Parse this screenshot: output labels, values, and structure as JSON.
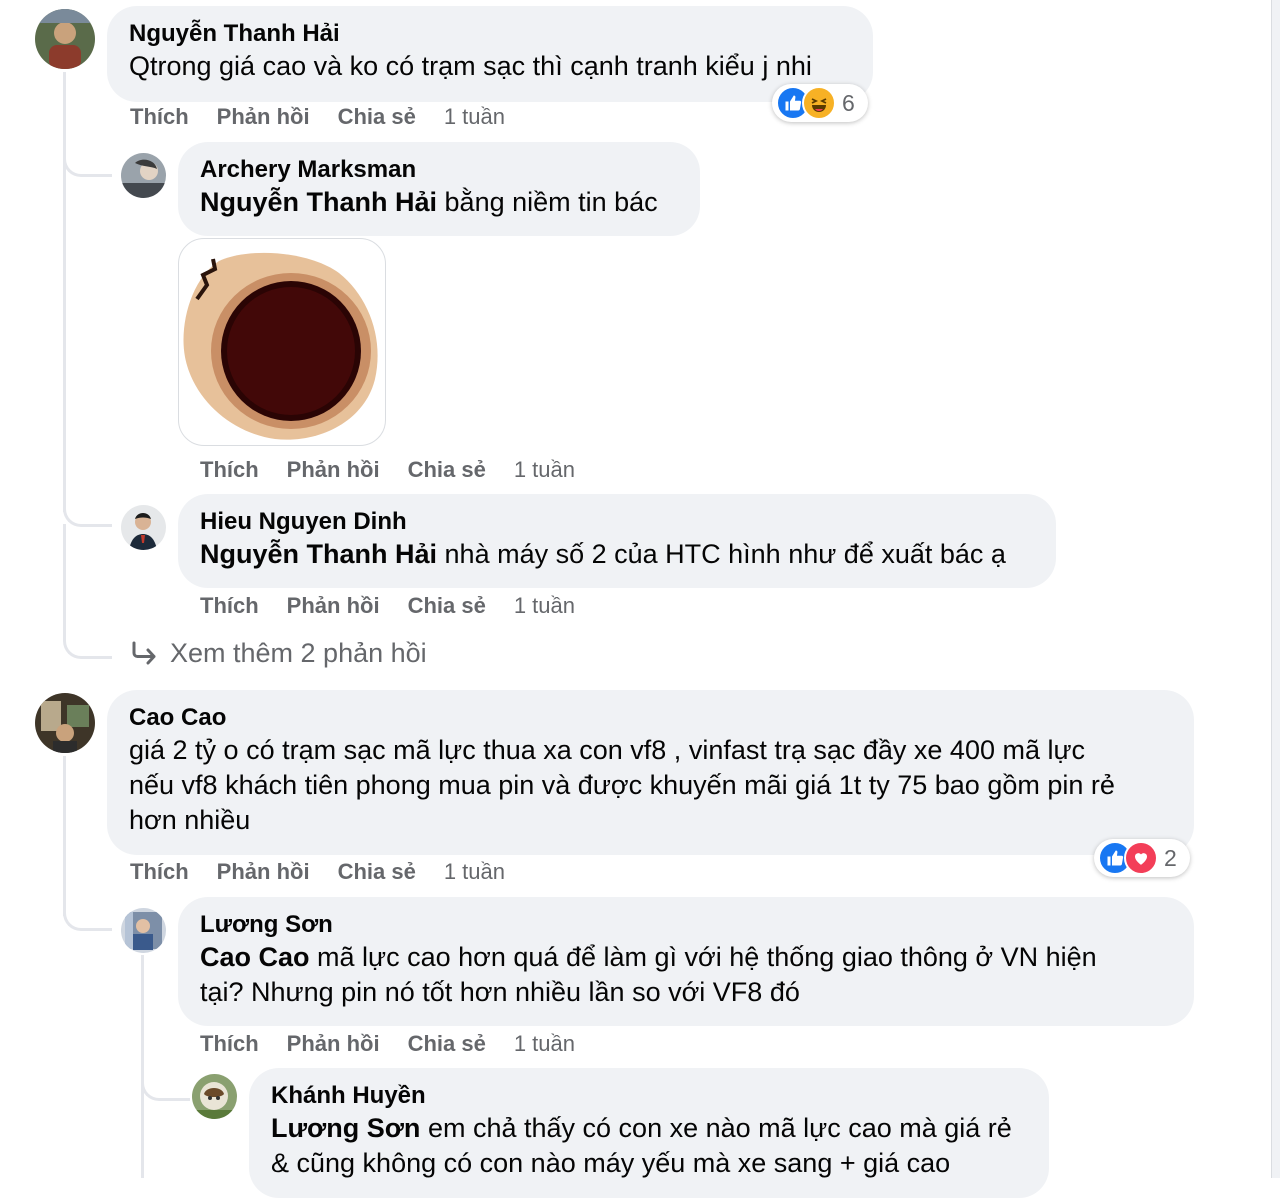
{
  "colors": {
    "accent": "#1877f2",
    "love": "#f33e58",
    "haha": "#f7b125",
    "bubble": "#f0f2f5",
    "meta": "#65676b"
  },
  "c1": {
    "author": "Nguyễn Thanh Hải",
    "text": "Qtrong giá cao và ko có trạm sạc thì cạnh tranh kiểu j nhi",
    "actions": {
      "like": "Thích",
      "reply": "Phản hồi",
      "share": "Chia sẻ",
      "time": "1 tuần"
    },
    "reactions": {
      "icons": [
        "like-icon",
        "haha-icon"
      ],
      "count": "6"
    }
  },
  "r1": {
    "author": "Archery Marksman",
    "mention": "Nguyễn Thanh Hải",
    "text": "bằng niềm tin bác",
    "sticker": "sticker-image",
    "actions": {
      "like": "Thích",
      "reply": "Phản hồi",
      "share": "Chia sẻ",
      "time": "1 tuần"
    }
  },
  "r2": {
    "author": "Hieu Nguyen Dinh",
    "mention": "Nguyễn Thanh Hải",
    "text": "nhà máy số 2 của HTC hình như để xuất bác ạ",
    "actions": {
      "like": "Thích",
      "reply": "Phản hồi",
      "share": "Chia sẻ",
      "time": "1 tuần"
    }
  },
  "more_replies": {
    "label": "Xem thêm 2 phản hồi"
  },
  "c2": {
    "author": "Cao Cao",
    "line1": "giá 2 tỷ o có trạm sạc mã lực thua xa con vf8 , vinfast trạ sạc đầy xe 400 mã lực",
    "line2": "nếu vf8 khách tiên phong mua pin và được khuyến mãi giá 1t ty 75 bao gồm pin rẻ",
    "line3": "hơn nhiều",
    "actions": {
      "like": "Thích",
      "reply": "Phản hồi",
      "share": "Chia sẻ",
      "time": "1 tuần"
    },
    "reactions": {
      "icons": [
        "like-icon",
        "love-icon"
      ],
      "count": "2"
    }
  },
  "r3": {
    "author": "Lương Sơn",
    "mention": "Cao Cao",
    "line1": "mã lực cao hơn quá để làm gì với hệ thống giao thông ở VN hiện",
    "line2": "tại? Nhưng pin nó tốt hơn nhiều lần so với VF8 đó",
    "actions": {
      "like": "Thích",
      "reply": "Phản hồi",
      "share": "Chia sẻ",
      "time": "1 tuần"
    }
  },
  "r4": {
    "author": "Khánh Huyền",
    "mention": "Lương Sơn",
    "line1": "em chả thấy có con xe nào mã lực cao mà giá rẻ",
    "line2": "& cũng không có con nào máy yếu mà xe sang + giá cao"
  }
}
